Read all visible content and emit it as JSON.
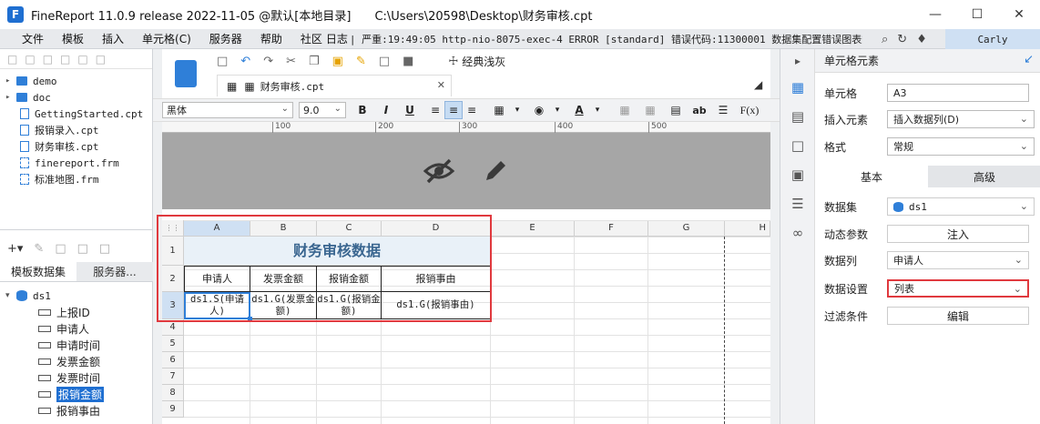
{
  "window": {
    "title": "FineReport 11.0.9 release 2022-11-05 @默认[本地目录]",
    "path": "C:\\Users\\20598\\Desktop\\财务审核.cpt"
  },
  "menu": {
    "items": [
      "文件",
      "模板",
      "插入",
      "单元格(C)",
      "服务器",
      "帮助",
      "社区",
      "日志"
    ],
    "error_text": "| 严重:19:49:05 http-nio-8075-exec-4 ERROR [standard] 错误代码:11300001 数据集配置错误图表数...",
    "user": "Carly"
  },
  "left_panel": {
    "tree": [
      {
        "type": "folder",
        "label": "demo"
      },
      {
        "type": "folder",
        "label": "doc"
      },
      {
        "type": "file",
        "label": "GettingStarted.cpt"
      },
      {
        "type": "file",
        "label": "报销录入.cpt"
      },
      {
        "type": "file",
        "label": "财务审核.cpt"
      },
      {
        "type": "file",
        "label": "finereport.frm"
      },
      {
        "type": "file",
        "label": "标准地图.frm"
      }
    ],
    "tabs": [
      "模板数据集",
      "服务器..."
    ],
    "dataset": "ds1",
    "fields": [
      "上报ID",
      "申请人",
      "申请时间",
      "发票金额",
      "发票时间",
      "报销金额",
      "报销事由"
    ],
    "selected_field": "报销金额"
  },
  "toolbar": {
    "style_label": "经典浅灰",
    "file_tab": "财务审核.cpt"
  },
  "format_bar": {
    "font": "黑体",
    "size": "9.0",
    "bold": "B",
    "italic": "I",
    "underline": "U",
    "text_a": "A",
    "ab": "ab",
    "fx": "F(x)"
  },
  "ruler": {
    "ticks": [
      "100",
      "200",
      "300",
      "400",
      "500"
    ]
  },
  "grid": {
    "columns": [
      "A",
      "B",
      "C",
      "D",
      "E",
      "F",
      "G",
      "H"
    ],
    "rows": [
      "1",
      "2",
      "3",
      "4",
      "5",
      "6",
      "7",
      "8",
      "9"
    ],
    "title": "财务审核数据",
    "headers": [
      "申请人",
      "发票金额",
      "报销金额",
      "报销事由"
    ],
    "row3": [
      "ds1.S(申请人)",
      "ds1.G(发票金额)",
      "ds1.G(报销金额)",
      "ds1.G(报销事由)"
    ]
  },
  "right_panel": {
    "title": "单元格元素",
    "cell_label": "单元格",
    "cell_value": "A3",
    "insert_label": "插入元素",
    "insert_value": "插入数据列(D)",
    "format_label": "格式",
    "format_value": "常规",
    "tab_basic": "基本",
    "tab_advanced": "高级",
    "dataset_label": "数据集",
    "dataset_value": "ds1",
    "dynamic_label": "动态参数",
    "dynamic_button": "注入",
    "column_label": "数据列",
    "column_value": "申请人",
    "setting_label": "数据设置",
    "setting_value": "列表",
    "filter_label": "过滤条件",
    "filter_button": "编辑"
  },
  "colors": {
    "accent": "#1f6fd1",
    "highlight_red": "#e0393e",
    "title_text": "#3a6690"
  }
}
